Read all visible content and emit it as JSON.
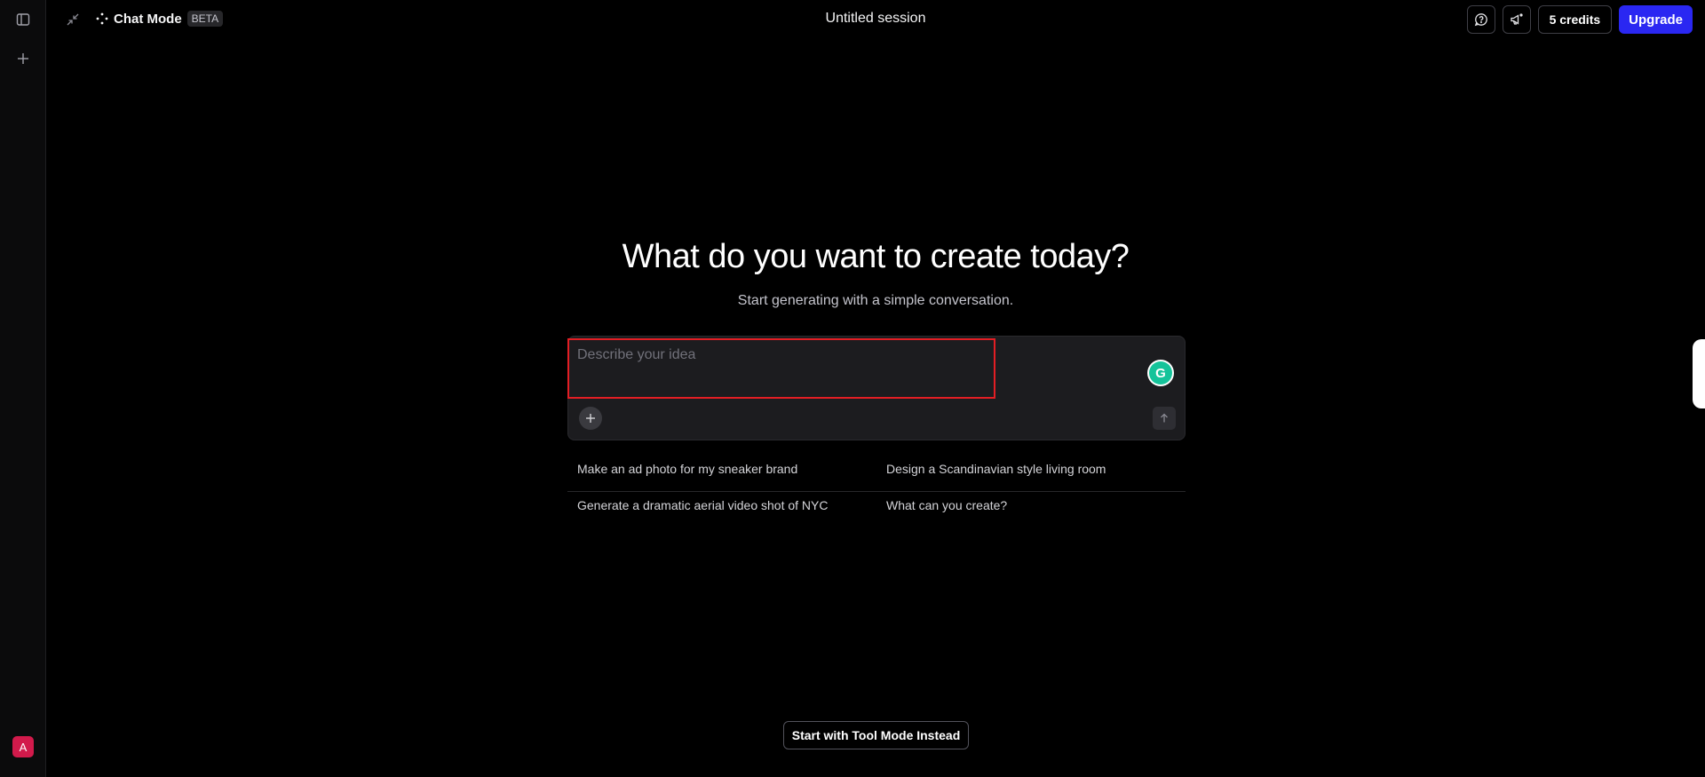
{
  "header": {
    "mode_label": "Chat Mode",
    "mode_badge": "BETA",
    "session_title": "Untitled session",
    "credits_label": "5 credits",
    "upgrade_label": "Upgrade"
  },
  "sidebar": {
    "avatar_initial": "A"
  },
  "main": {
    "title": "What do you want to create today?",
    "subtitle": "Start generating with a simple conversation.",
    "prompt_placeholder": "Describe your idea",
    "suggestions": [
      [
        "Make an ad photo for my sneaker brand",
        "Design a Scandinavian style living room"
      ],
      [
        "Generate a dramatic aerial video shot of NYC",
        "What can you create?"
      ]
    ],
    "tool_mode_label": "Start with Tool Mode Instead"
  },
  "icons": {
    "sidebar_toggle": "sidebar-toggle-icon",
    "new": "plus-icon",
    "collapse": "collapse-arrows-icon",
    "mode": "sparkle-dots-icon",
    "feedback": "chat-help-icon",
    "announcements": "megaphone-icon",
    "grammarly": "grammarly-icon",
    "attach": "plus-icon",
    "send": "arrow-up-icon"
  },
  "colors": {
    "background": "#000000",
    "accent": "#2a27f2",
    "highlight_border": "#e31e24",
    "avatar": "#d21a4b"
  }
}
